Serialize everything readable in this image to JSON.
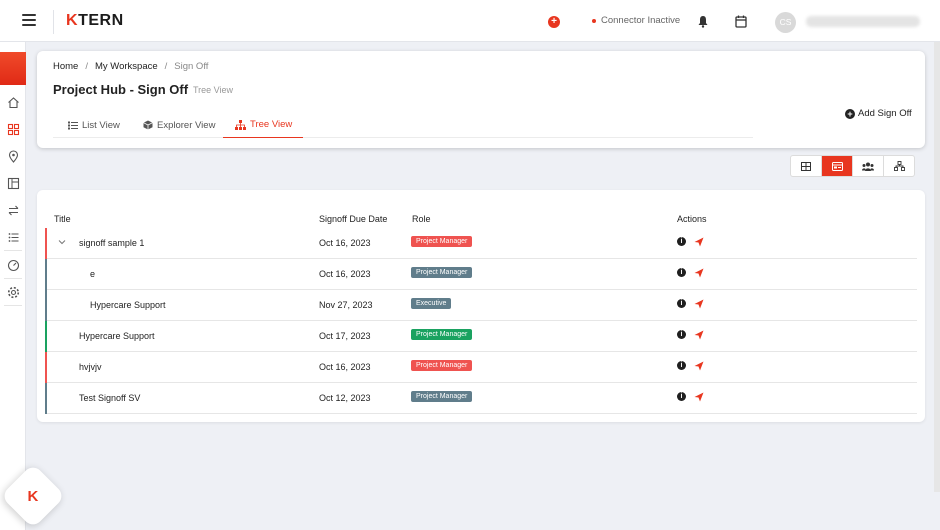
{
  "app": {
    "logo_k": "K",
    "logo_rest": "TERN"
  },
  "topbar": {
    "connector_status": "Connector Inactive",
    "avatar_initials": "CS",
    "accent_color": "#e8361f"
  },
  "breadcrumb": {
    "home": "Home",
    "workspace": "My Workspace",
    "current": "Sign Off"
  },
  "page": {
    "title": "Project Hub - Sign Off",
    "subtitle": "Tree View"
  },
  "tabs": [
    {
      "label": "List View",
      "icon": "list-icon"
    },
    {
      "label": "Explorer View",
      "icon": "cube-icon"
    },
    {
      "label": "Tree View",
      "icon": "sitemap-icon",
      "active": true
    }
  ],
  "actions": {
    "add_signoff": "Add Sign Off"
  },
  "view_toggles": [
    "table-icon",
    "card-icon",
    "users-icon",
    "hierarchy-icon"
  ],
  "table": {
    "headers": {
      "title": "Title",
      "due": "Signoff Due Date",
      "role": "Role",
      "actions": "Actions"
    },
    "rows": [
      {
        "title": "signoff sample 1",
        "due": "Oct 16, 2023",
        "role": "Project Manager",
        "role_color": "#ef5350",
        "bar_color": "#ef5350"
      },
      {
        "title": "e",
        "due": "Oct 16, 2023",
        "role": "Project Manager",
        "role_color": "#607d8b",
        "bar_color": "#607d8b"
      },
      {
        "title": "Hypercare Support",
        "due": "Nov 27, 2023",
        "role": "Executive",
        "role_color": "#607d8b",
        "bar_color": "#607d8b"
      },
      {
        "title": "Hypercare Support",
        "due": "Oct 17, 2023",
        "role": "Project Manager",
        "role_color": "#1aa260",
        "bar_color": "#1aa260"
      },
      {
        "title": "hvjvjv",
        "due": "Oct 16, 2023",
        "role": "Project Manager",
        "role_color": "#ef5350",
        "bar_color": "#ef5350"
      },
      {
        "title": "Test Signoff SV",
        "due": "Oct 12, 2023",
        "role": "Project Manager",
        "role_color": "#607d8b",
        "bar_color": "#607d8b"
      }
    ]
  }
}
